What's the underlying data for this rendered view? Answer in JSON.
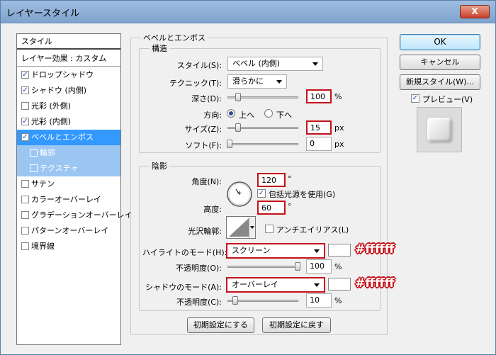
{
  "window": {
    "title": "レイヤースタイル",
    "close_label": "X"
  },
  "styles_list": {
    "header": "スタイル",
    "blend_options": "レイヤー効果 : カスタム",
    "items": [
      {
        "label": "ドロップシャドウ",
        "checked": true
      },
      {
        "label": "シャドウ (内側)",
        "checked": true
      },
      {
        "label": "光彩 (外側)",
        "checked": false
      },
      {
        "label": "光彩 (内側)",
        "checked": true
      },
      {
        "label": "ベベルとエンボス",
        "checked": true,
        "selected": true
      },
      {
        "label": "輪郭",
        "checked": false,
        "sub": true
      },
      {
        "label": "テクスチャ",
        "checked": false,
        "sub": true
      },
      {
        "label": "サテン",
        "checked": false
      },
      {
        "label": "カラーオーバーレイ",
        "checked": false
      },
      {
        "label": "グラデーションオーバーレイ",
        "checked": false
      },
      {
        "label": "パターンオーバーレイ",
        "checked": false
      },
      {
        "label": "境界線",
        "checked": false
      }
    ]
  },
  "bevel": {
    "title": "ベベルとエンボス",
    "structure": {
      "title": "構造",
      "style_label": "スタイル(S):",
      "style_value": "ベベル (内側)",
      "technique_label": "テクニック(T):",
      "technique_value": "滑らかに",
      "depth_label": "深さ(D):",
      "depth_value": "100",
      "depth_unit": "%",
      "direction_label": "方向:",
      "dir_up": "上へ",
      "dir_down": "下へ",
      "size_label": "サイズ(Z):",
      "size_value": "15",
      "size_unit": "px",
      "soften_label": "ソフト(F):",
      "soften_value": "0",
      "soften_unit": "px"
    },
    "shading": {
      "title": "陰影",
      "angle_label": "角度(N):",
      "angle_value": "120",
      "angle_unit": "°",
      "global_light_label": "包括光源を使用(G)",
      "altitude_label": "高度:",
      "altitude_value": "60",
      "altitude_unit": "°",
      "gloss_label": "光沢輪郭:",
      "antialias_label": "アンチエイリアス(L)",
      "highlight_mode_label": "ハイライトのモード(H):",
      "highlight_mode_value": "スクリーン",
      "highlight_opacity_label": "不透明度(O):",
      "highlight_opacity_value": "100",
      "highlight_opacity_unit": "%",
      "shadow_mode_label": "シャドウのモード(A):",
      "shadow_mode_value": "オーバーレイ",
      "shadow_opacity_label": "不透明度(C):",
      "shadow_opacity_value": "10",
      "shadow_opacity_unit": "%"
    },
    "make_default": "初期設定にする",
    "reset_default": "初期設定に戻す"
  },
  "annotations": {
    "highlight_color": "#ffffff",
    "shadow_color": "#ffffff"
  },
  "buttons": {
    "ok": "OK",
    "cancel": "キャンセル",
    "new_style": "新規スタイル(W)...",
    "preview": "プレビュー(V)"
  },
  "colors": {
    "accent_red": "#c4121a",
    "selection_blue": "#3399ff",
    "highlight_swatch": "#ffffff",
    "shadow_swatch": "#ffffff"
  }
}
